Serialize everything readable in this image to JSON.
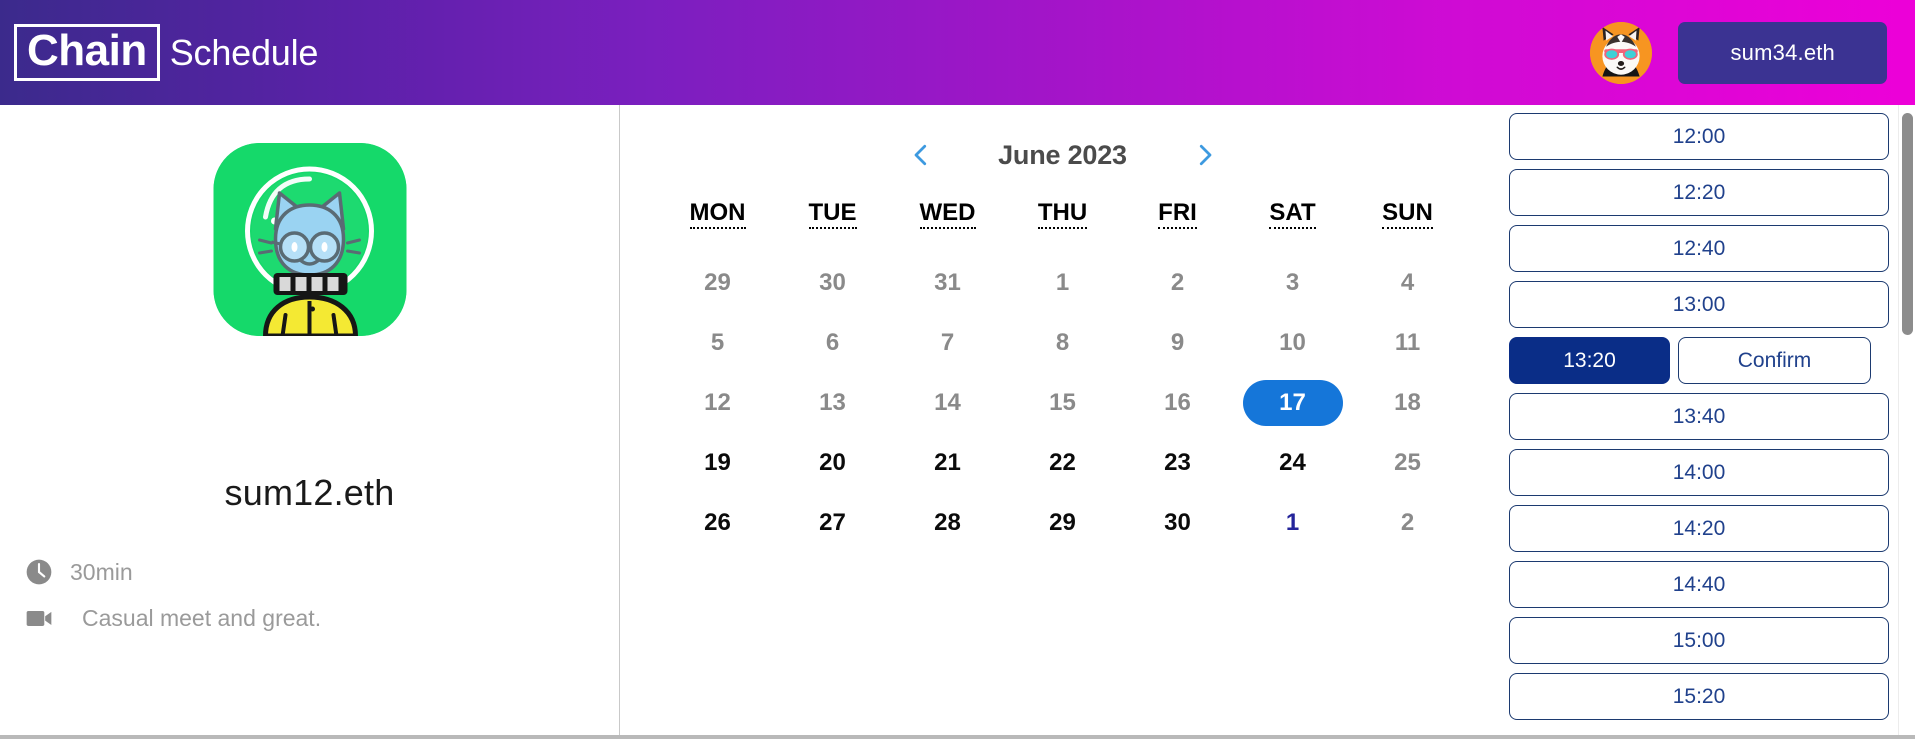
{
  "header": {
    "brand_mark": "Chain",
    "brand_word": "Schedule",
    "avatar_icon": "shiba-dog-avatar",
    "wallet_label": "sum34.eth",
    "gradient_start": "#3b2a8c",
    "gradient_end": "#ed00d8",
    "wallet_bg": "#3b3392"
  },
  "profile": {
    "avatar_icon": "astronaut-cat-avatar",
    "avatar_bg": "#15d96a",
    "name": "sum12.eth",
    "details": [
      {
        "icon": "clock-icon",
        "text": "30min"
      },
      {
        "icon": "video-camera-icon",
        "text": "Casual meet and great."
      }
    ]
  },
  "calendar": {
    "prev_icon": "chevron-left-icon",
    "next_icon": "chevron-right-icon",
    "title": "June 2023",
    "weekdays": [
      "MON",
      "TUE",
      "WED",
      "THU",
      "FRI",
      "SAT",
      "SUN"
    ],
    "selected_day": 17,
    "selected_color": "#1576d9",
    "weeks": [
      [
        {
          "n": "29",
          "state": "muted"
        },
        {
          "n": "30",
          "state": "muted"
        },
        {
          "n": "31",
          "state": "muted"
        },
        {
          "n": "1",
          "state": "muted"
        },
        {
          "n": "2",
          "state": "muted"
        },
        {
          "n": "3",
          "state": "muted"
        },
        {
          "n": "4",
          "state": "muted"
        }
      ],
      [
        {
          "n": "5",
          "state": "muted"
        },
        {
          "n": "6",
          "state": "muted"
        },
        {
          "n": "7",
          "state": "muted"
        },
        {
          "n": "8",
          "state": "muted"
        },
        {
          "n": "9",
          "state": "muted"
        },
        {
          "n": "10",
          "state": "muted"
        },
        {
          "n": "11",
          "state": "muted"
        }
      ],
      [
        {
          "n": "12",
          "state": "muted"
        },
        {
          "n": "13",
          "state": "muted"
        },
        {
          "n": "14",
          "state": "muted"
        },
        {
          "n": "15",
          "state": "muted"
        },
        {
          "n": "16",
          "state": "muted"
        },
        {
          "n": "17",
          "state": "selected"
        },
        {
          "n": "18",
          "state": "muted"
        }
      ],
      [
        {
          "n": "19",
          "state": "active"
        },
        {
          "n": "20",
          "state": "active"
        },
        {
          "n": "21",
          "state": "active"
        },
        {
          "n": "22",
          "state": "active"
        },
        {
          "n": "23",
          "state": "active"
        },
        {
          "n": "24",
          "state": "active"
        },
        {
          "n": "25",
          "state": "muted"
        }
      ],
      [
        {
          "n": "26",
          "state": "active"
        },
        {
          "n": "27",
          "state": "active"
        },
        {
          "n": "28",
          "state": "active"
        },
        {
          "n": "29",
          "state": "active"
        },
        {
          "n": "30",
          "state": "active"
        },
        {
          "n": "1",
          "state": "nextmonth"
        },
        {
          "n": "2",
          "state": "muted"
        }
      ]
    ]
  },
  "slots": {
    "selected": "13:20",
    "confirm_label": "Confirm",
    "selected_bg": "#0a2d87",
    "border_color": "#1c3a70",
    "text_color": "#20418c",
    "times": [
      "12:00",
      "12:20",
      "12:40",
      "13:00",
      "13:20",
      "13:40",
      "14:00",
      "14:20",
      "14:40",
      "15:00",
      "15:20"
    ]
  }
}
